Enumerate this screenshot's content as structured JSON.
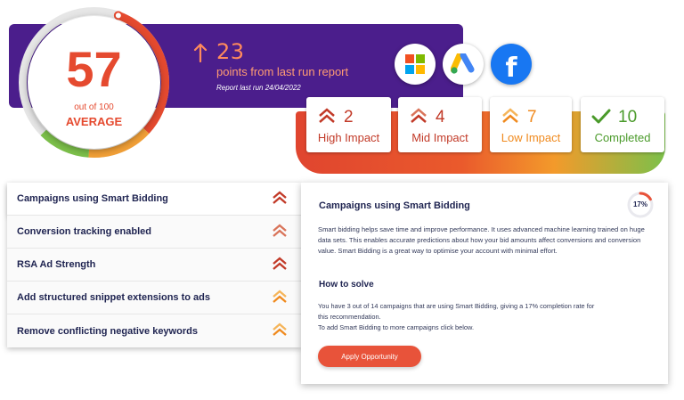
{
  "score": {
    "value": "57",
    "out_of": "out of 100",
    "label": "AVERAGE",
    "ring_colors": [
      "#e54a2f",
      "#f2a037",
      "#7cc04a"
    ]
  },
  "banner": {
    "delta": "23",
    "points_text": "points from last run report",
    "last_run": "Report last run 24/04/2022",
    "bg_color": "#4b1e8c",
    "accent_color": "#ff8a5c"
  },
  "platforms": [
    {
      "name": "microsoft-logo"
    },
    {
      "name": "google-ads-logo"
    },
    {
      "name": "facebook-logo",
      "glyph": "f"
    }
  ],
  "impacts": {
    "high": {
      "count": "2",
      "label": "High Impact"
    },
    "mid": {
      "count": "4",
      "label": "Mid Impact"
    },
    "low": {
      "count": "7",
      "label": "Low Impact"
    },
    "done": {
      "count": "10",
      "label": "Completed"
    }
  },
  "recommendations": [
    {
      "label": "Campaigns using Smart Bidding",
      "impact": "high"
    },
    {
      "label": "Conversion tracking enabled",
      "impact": "high"
    },
    {
      "label": "RSA Ad Strength",
      "impact": "high"
    },
    {
      "label": "Add structured snippet extensions to ads",
      "impact": "low"
    },
    {
      "label": "Remove conflicting negative keywords",
      "impact": "low"
    }
  ],
  "detail": {
    "title": "Campaigns using Smart Bidding",
    "percent": "17%",
    "percent_value": 0.17,
    "description": "Smart bidding helps save time and improve performance. It uses advanced machine learning trained on huge data sets. This enables accurate predictions about how your bid amounts affect conversions and conversion value. Smart Bidding is a great way to optimise your account with minimal effort.",
    "how_title": "How to solve",
    "solve_text": "You have 3 out of 14 campaigns that are using Smart Bidding, giving a 17% completion rate for this recommendation.",
    "solve_text2": "To add Smart Bidding to more campaigns click below.",
    "button": "Apply Opportunity"
  }
}
